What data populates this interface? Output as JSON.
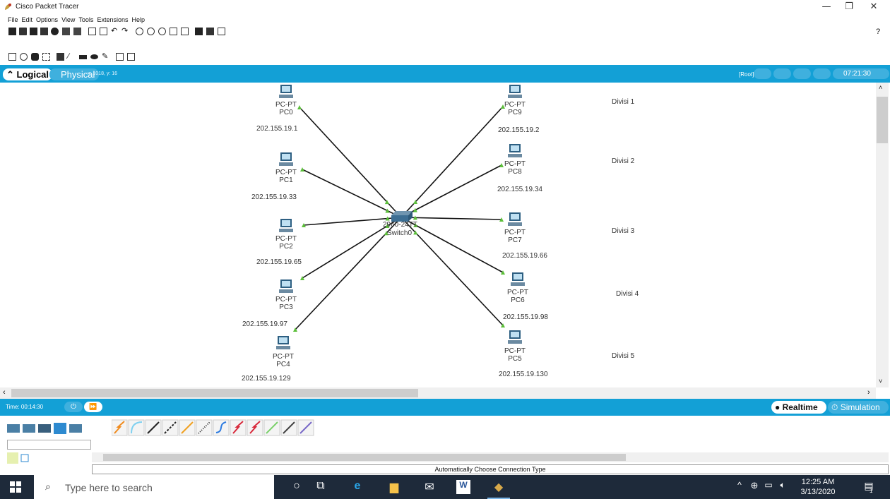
{
  "window": {
    "title": "Cisco Packet Tracer",
    "controls": [
      "—",
      "❐",
      "✕"
    ]
  },
  "menu": [
    "File",
    "Edit",
    "Options",
    "View",
    "Tools",
    "Extensions",
    "Help"
  ],
  "toolbar": {
    "help": "?"
  },
  "modebar": {
    "logical": "Logical",
    "physical": "Physical",
    "coords": "x: 1018, y: 16",
    "root": "[Root]",
    "clock": "07:21:30"
  },
  "canvas": {
    "switch": {
      "model": "2960-24TT",
      "name": "Switch0"
    },
    "pcs": [
      {
        "type": "PC-PT",
        "name": "PC0",
        "ip": "202.155.19.1"
      },
      {
        "type": "PC-PT",
        "name": "PC1",
        "ip": "202.155.19.33"
      },
      {
        "type": "PC-PT",
        "name": "PC2",
        "ip": "202.155.19.65"
      },
      {
        "type": "PC-PT",
        "name": "PC3",
        "ip": "202.155.19.97"
      },
      {
        "type": "PC-PT",
        "name": "PC4",
        "ip": "202.155.19.129"
      },
      {
        "type": "PC-PT",
        "name": "PC9",
        "ip": "202.155.19.2"
      },
      {
        "type": "PC-PT",
        "name": "PC8",
        "ip": "202.155.19.34"
      },
      {
        "type": "PC-PT",
        "name": "PC7",
        "ip": "202.155.19.66"
      },
      {
        "type": "PC-PT",
        "name": "PC6",
        "ip": "202.155.19.98"
      },
      {
        "type": "PC-PT",
        "name": "PC5",
        "ip": "202.155.19.130"
      }
    ],
    "divisions": [
      "Divisi 1",
      "Divisi 2",
      "Divisi 3",
      "Divisi 4",
      "Divisi 5"
    ]
  },
  "timebar": {
    "time": "Time: 00:14:30",
    "realtime": "Realtime",
    "simulation": "Simulation"
  },
  "bottom": {
    "connection_label": "Automatically Choose Connection Type"
  },
  "taskbar": {
    "search_placeholder": "Type here to search",
    "time": "12:25 AM",
    "date": "3/13/2020",
    "notification_count": "1"
  },
  "colors": {
    "accent": "#13a0d6",
    "link": "#111111",
    "port": "#5cbf3a"
  }
}
